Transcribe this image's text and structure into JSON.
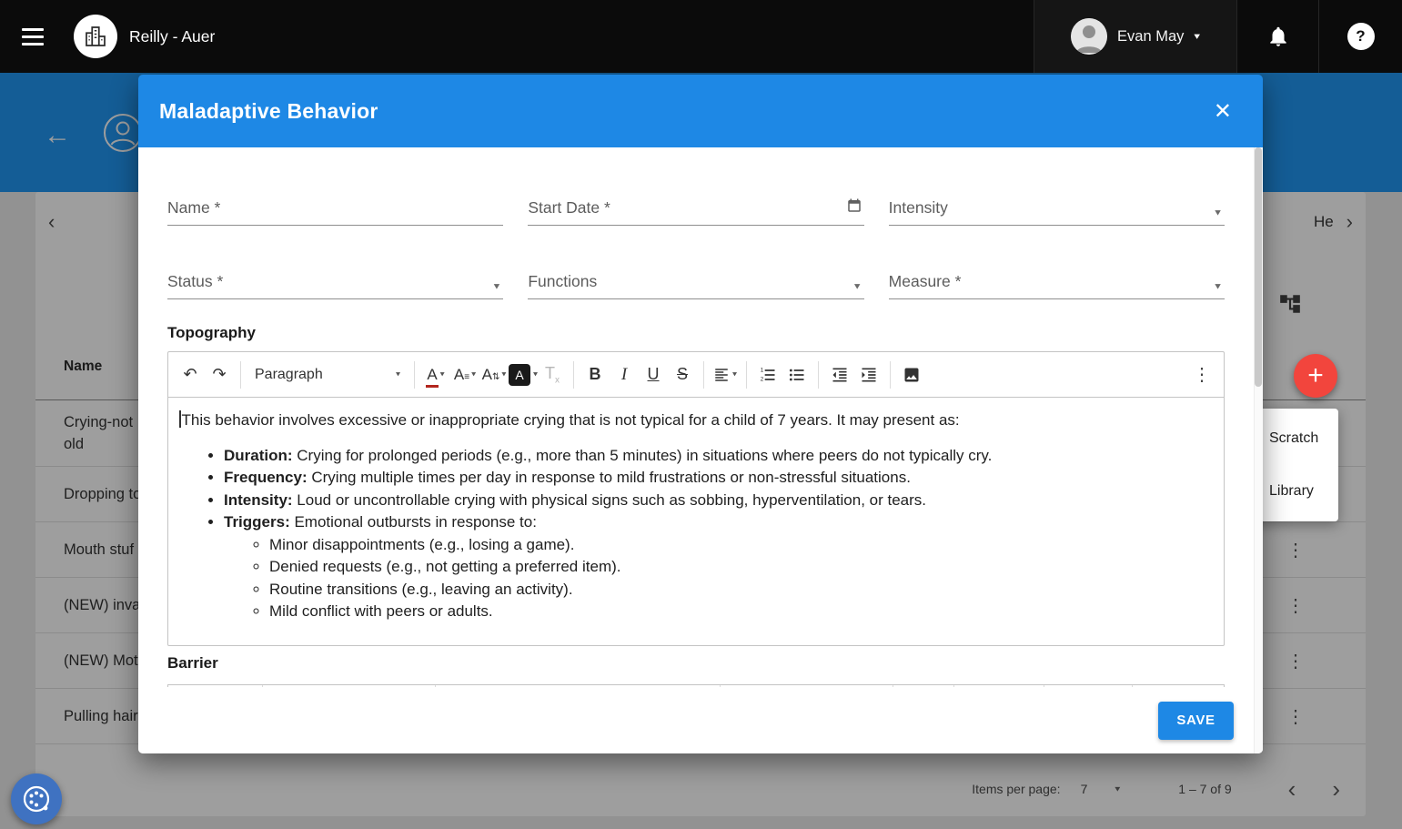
{
  "colors": {
    "topbar_bg": "#0b0b0b",
    "page_header_blue": "#2196f3",
    "modal_header_blue": "#1e88e5",
    "save_button_blue": "#1e88e5",
    "fab_red": "#f2453d",
    "widget_fab_blue": "#3f72c1",
    "font_color_bar": "#b3261e"
  },
  "icons": {
    "back": "←",
    "plus": "+",
    "close": "✕",
    "more_vertical": "⋮",
    "undo": "↶",
    "redo": "↷",
    "chevron_left": "‹",
    "chevron_right": "›",
    "caret_down": "▾",
    "dropdown": "▼",
    "letter_a": "A",
    "size_lines": "≡",
    "updown": "⇅",
    "align_lines": "≡",
    "bold": "B",
    "italic": "I",
    "underline": "U",
    "strikethrough": "S",
    "clear_t": "T",
    "clear_x": "x",
    "question": "?"
  },
  "topbar": {
    "app_title": "Reilly - Auer",
    "user_name": "Evan May"
  },
  "background": {
    "panel_header_text": "He",
    "table": {
      "name_header": "Name",
      "rows": [
        {
          "line1": "Crying-not",
          "line2": "old"
        },
        {
          "line1": "Dropping to"
        },
        {
          "line1": "Mouth stuf"
        },
        {
          "line1": "(NEW) inva"
        },
        {
          "line1": "(NEW) Mot"
        },
        {
          "line1": "Pulling hair"
        }
      ]
    },
    "fab_menu": {
      "items": [
        {
          "label": "Scratch"
        },
        {
          "label": "Library"
        }
      ]
    },
    "pagination": {
      "items_per_page_label": "Items per page:",
      "per_page": "7",
      "range": "1 – 7 of 9"
    }
  },
  "modal": {
    "title": "Maladaptive Behavior",
    "fields": {
      "name": {
        "label": "Name *"
      },
      "start_date": {
        "label": "Start Date *"
      },
      "intensity": {
        "label": "Intensity"
      },
      "status": {
        "label": "Status *"
      },
      "functions": {
        "label": "Functions"
      },
      "measure": {
        "label": "Measure *"
      }
    },
    "sections": {
      "topography": "Topography",
      "barrier": "Barrier"
    },
    "editor": {
      "paragraph_dropdown": "Paragraph",
      "intro": "This behavior involves excessive or inappropriate crying that is not typical for a child of 7 years. It may present as:",
      "bullets": [
        {
          "lead": "Duration:",
          "text": " Crying for prolonged periods (e.g., more than 5 minutes) in situations where peers do not typically cry."
        },
        {
          "lead": "Frequency:",
          "text": " Crying multiple times per day in response to mild frustrations or non-stressful situations."
        },
        {
          "lead": "Intensity:",
          "text": " Loud or uncontrollable crying with physical signs such as sobbing, hyperventilation, or tears."
        },
        {
          "lead": "Triggers:",
          "text": " Emotional outbursts in response to:"
        }
      ],
      "sub_bullets": [
        "Minor disappointments (e.g., losing a game).",
        "Denied requests (e.g., not getting a preferred item).",
        "Routine transitions (e.g., leaving an activity).",
        "Mild conflict with peers or adults."
      ]
    },
    "save_label": "SAVE"
  }
}
